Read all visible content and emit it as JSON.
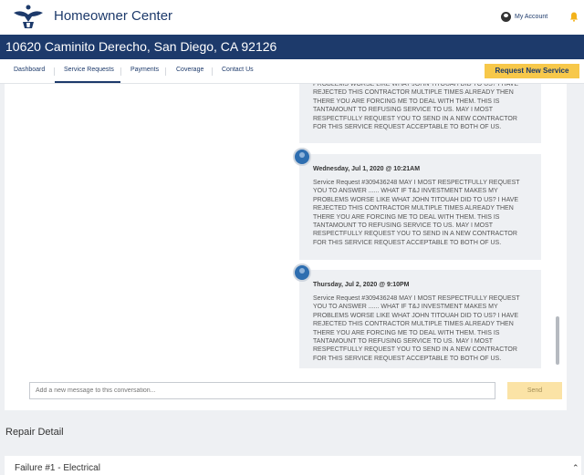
{
  "header": {
    "brand": "Homeowner Center",
    "account_label": "My Account",
    "account_icon": "user-circle-icon",
    "bell_icon": "bell-icon"
  },
  "address": "10620 Caminito Derecho, San Diego, CA 92126",
  "nav": {
    "tabs": [
      {
        "label": "Dashboard"
      },
      {
        "label": "Service Requests"
      },
      {
        "label": "Payments"
      },
      {
        "label": "Coverage"
      },
      {
        "label": "Contact Us"
      }
    ],
    "active_tab": "Service Requests",
    "request_button": "Request New Service"
  },
  "conversation": {
    "partial_message": "PROBLEMS WORSE LIKE WHAT JOHN TITOUAH DID TO US? I HAVE REJECTED THIS CONTRACTOR MULTIPLE TIMES ALREADY THEN THERE YOU ARE FORCING ME TO DEAL WITH THEM. THIS IS TANTAMOUNT TO REFUSING SERVICE TO US. MAY I MOST RESPECTFULLY REQUEST YOU TO SEND IN A NEW CONTRACTOR FOR THIS SERVICE REQUEST ACCEPTABLE TO BOTH OF US.",
    "messages": [
      {
        "date": "Wednesday, Jul 1, 2020 @ 10:21AM",
        "text": "Service Request #309436248 MAY I MOST RESPECTFULLY REQUEST YOU TO ANSWER ...... WHAT IF T&J INVESTMENT MAKES MY PROBLEMS WORSE LIKE WHAT JOHN TITOUAH DID TO US? I HAVE REJECTED THIS CONTRACTOR MULTIPLE TIMES ALREADY THEN THERE YOU ARE FORCING ME TO DEAL WITH THEM. THIS IS TANTAMOUNT TO REFUSING SERVICE TO US. MAY I MOST RESPECTFULLY REQUEST YOU TO SEND IN A NEW CONTRACTOR FOR THIS SERVICE REQUEST ACCEPTABLE TO BOTH OF US."
      },
      {
        "date": "Thursday, Jul 2, 2020 @ 9:10PM",
        "text": "Service Request #309436248 MAY I MOST RESPECTFULLY REQUEST YOU TO ANSWER ...... WHAT IF T&J INVESTMENT MAKES MY PROBLEMS WORSE LIKE WHAT JOHN TITOUAH DID TO US? I HAVE REJECTED THIS CONTRACTOR MULTIPLE TIMES ALREADY THEN THERE YOU ARE FORCING ME TO DEAL WITH THEM. THIS IS TANTAMOUNT TO REFUSING SERVICE TO US. MAY I MOST RESPECTFULLY REQUEST YOU TO SEND IN A NEW CONTRACTOR FOR THIS SERVICE REQUEST ACCEPTABLE TO BOTH OF US."
      }
    ],
    "input_placeholder": "Add a new message to this conversation...",
    "send_label": "Send"
  },
  "repair": {
    "title": "Repair Detail",
    "failure_label": "Failure #1 - Electrical"
  },
  "colors": {
    "navy": "#1d3a6b",
    "accent": "#f7c84a"
  }
}
